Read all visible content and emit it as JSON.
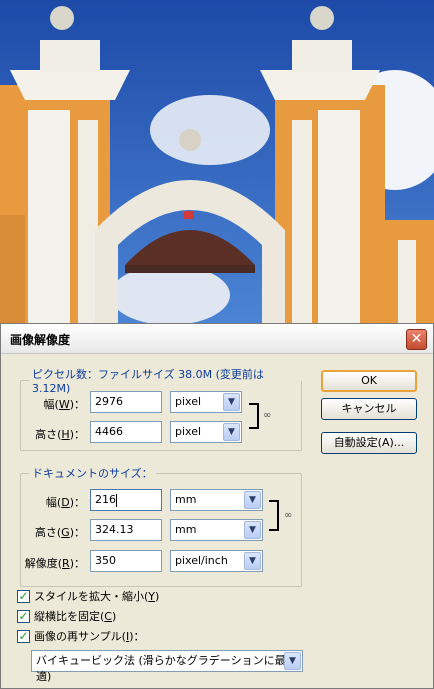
{
  "dialog": {
    "title": "画像解像度",
    "close_glyph": "✕"
  },
  "pixel_dimensions": {
    "legend": "ピクセル数：ファイルサイズ 38.0M (変更前は 3.12M)",
    "width": {
      "label_prefix": "幅(",
      "key": "W",
      "label_suffix": ")：",
      "value": "2976",
      "unit": "pixel"
    },
    "height": {
      "label_prefix": "高さ(",
      "key": "H",
      "label_suffix": ")：",
      "value": "4466",
      "unit": "pixel"
    }
  },
  "document_size": {
    "legend": "ドキュメントのサイズ：",
    "width": {
      "label_prefix": "幅(",
      "key": "D",
      "label_suffix": ")：",
      "value": "216",
      "unit": "mm"
    },
    "height": {
      "label_prefix": "高さ(",
      "key": "G",
      "label_suffix": ")：",
      "value": "324.13",
      "unit": "mm"
    },
    "resolution": {
      "label_prefix": "解像度(",
      "key": "R",
      "label_suffix": ")：",
      "value": "350",
      "unit": "pixel/inch"
    }
  },
  "buttons": {
    "ok": "OK",
    "cancel": "キャンセル",
    "auto": "自動設定(A)..."
  },
  "options": {
    "scale_styles": {
      "label_prefix": "スタイルを拡大・縮小(",
      "key": "Y",
      "label_suffix": ")",
      "checked": true
    },
    "constrain_proportions": {
      "label_prefix": "縦横比を固定(",
      "key": "C",
      "label_suffix": ")",
      "checked": true
    },
    "resample": {
      "label_prefix": "画像の再サンプル(",
      "key": "I",
      "label_suffix": ")：",
      "checked": true
    },
    "resample_method": "バイキュービック法 (滑らかなグラデーションに最適)"
  },
  "colors": {
    "accent_legend": "#0d3b9c",
    "check_mark": "#21a121",
    "default_button_border": "#e9a33c"
  }
}
